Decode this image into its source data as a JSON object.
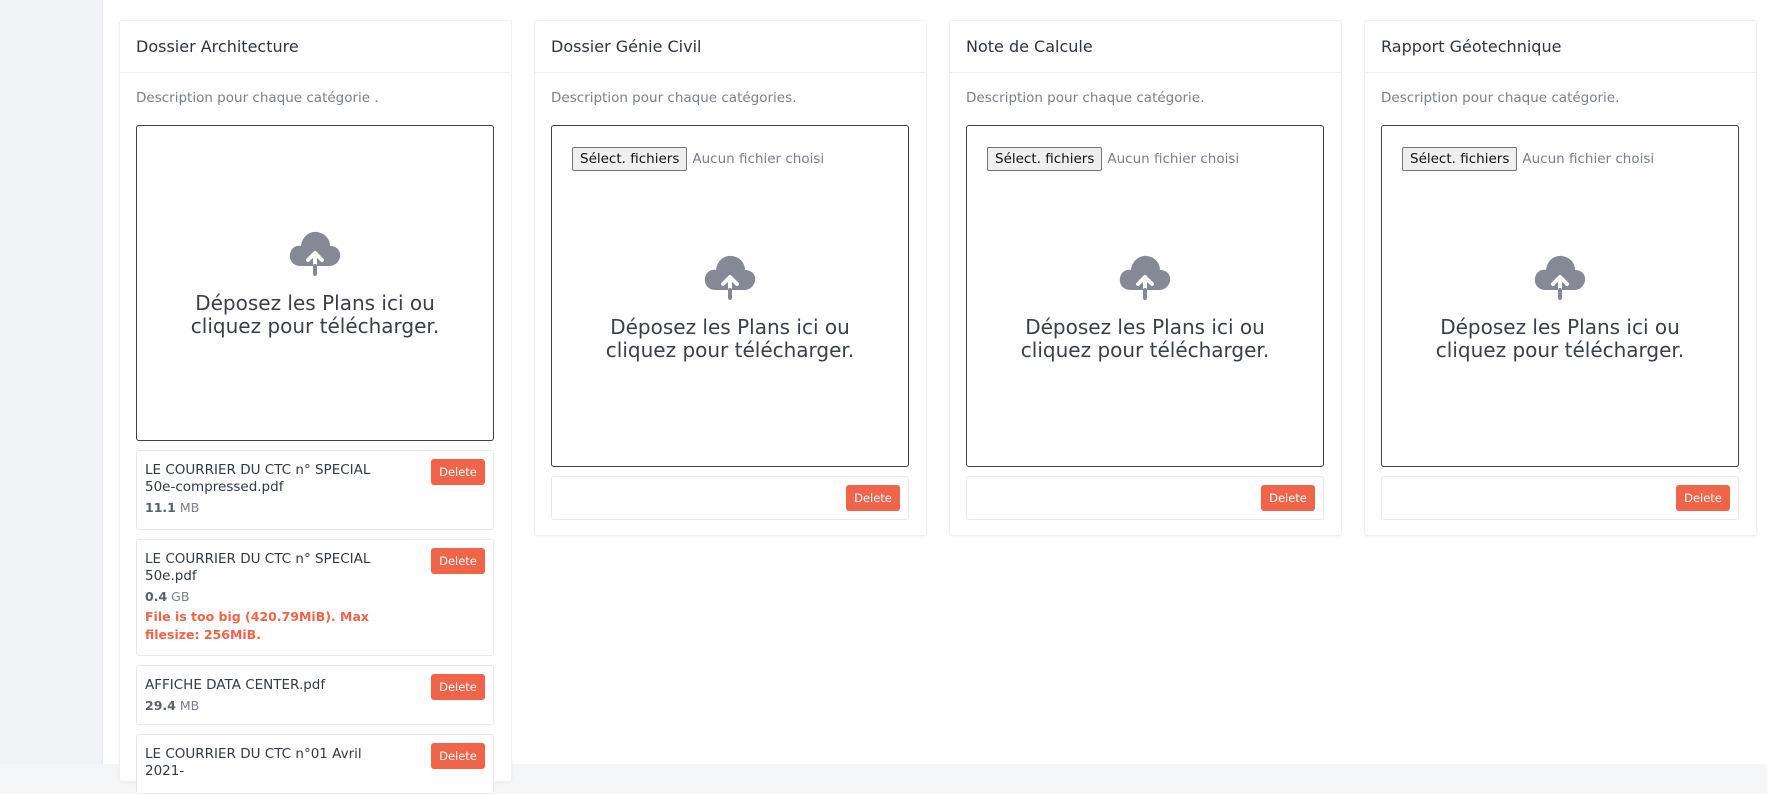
{
  "delete_label": "Delete",
  "select_files_label": "Sélect. fichiers",
  "no_file_label": "Aucun fichier choisi",
  "dropzone_message": "Déposez les Plans ici ou cliquez pour télécharger.",
  "colors": {
    "accent_delete": "#f0644a",
    "cloud_icon": "#858996",
    "error_text": "#f0644a"
  },
  "cards": [
    {
      "title": "Dossier Architecture",
      "description": "Description pour chaque catégorie .",
      "files": [
        {
          "name": "LE COURRIER DU CTC n° SPECIAL 50e-compressed.pdf",
          "size_value": "11.1",
          "size_unit": "MB",
          "error": ""
        },
        {
          "name": "LE COURRIER DU CTC n° SPECIAL 50e.pdf",
          "size_value": "0.4",
          "size_unit": "GB",
          "error": "File is too big (420.79MiB). Max filesize: 256MiB."
        },
        {
          "name": "AFFICHE DATA CENTER.pdf",
          "size_value": "29.4",
          "size_unit": "MB",
          "error": ""
        },
        {
          "name": "LE COURRIER DU CTC n°01 Avril 2021-",
          "size_value": "",
          "size_unit": "",
          "error": ""
        }
      ]
    },
    {
      "title": "Dossier Génie Civil",
      "description": "Description pour chaque catégories.",
      "files": []
    },
    {
      "title": "Note de Calcule",
      "description": "Description pour chaque catégorie.",
      "files": []
    },
    {
      "title": "Rapport Géotechnique",
      "description": "Description pour chaque catégorie.",
      "files": []
    }
  ]
}
